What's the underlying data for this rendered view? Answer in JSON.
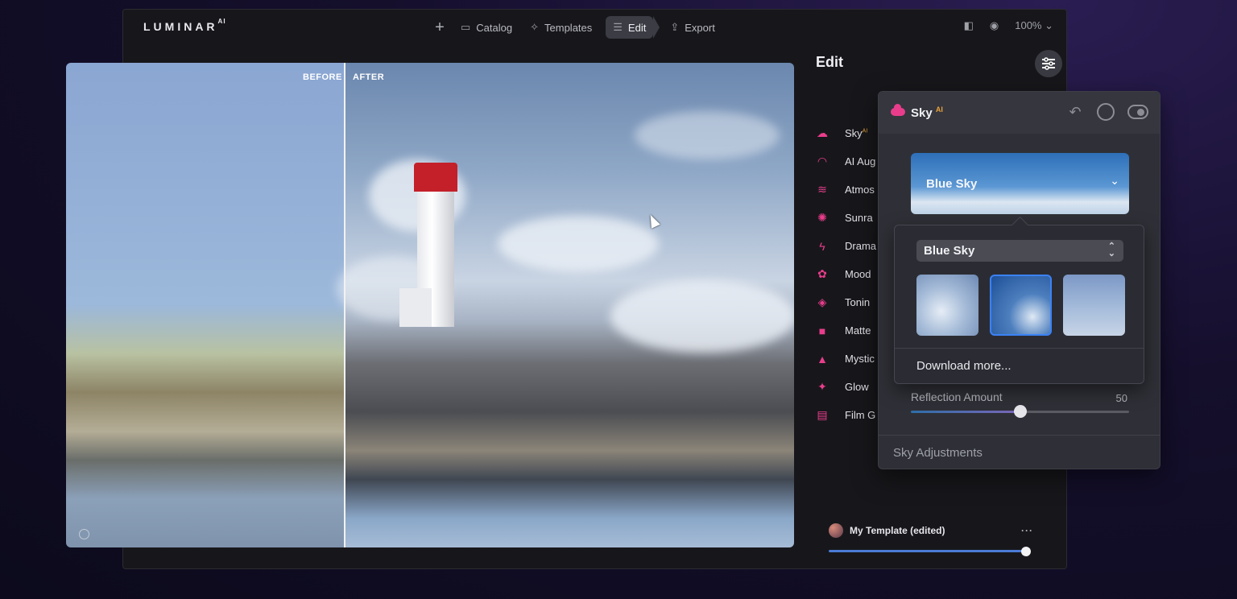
{
  "app": {
    "logo": "LUMINAR",
    "logo_sup": "AI"
  },
  "nav": {
    "plus": "+",
    "catalog": "Catalog",
    "templates": "Templates",
    "edit": "Edit",
    "export": "Export"
  },
  "view": {
    "zoom": "100%"
  },
  "canvas": {
    "before_label": "BEFORE",
    "after_label": "AFTER"
  },
  "sidebar": {
    "title": "Edit",
    "tools": [
      {
        "label": "Sky",
        "sup": "AI",
        "icon": "cloud-icon"
      },
      {
        "label": "AI Aug",
        "icon": "rainbow-icon"
      },
      {
        "label": "Atmos",
        "icon": "waves-icon"
      },
      {
        "label": "Sunra",
        "icon": "sun-icon"
      },
      {
        "label": "Drama",
        "icon": "bolt-icon"
      },
      {
        "label": "Mood",
        "icon": "flower-icon"
      },
      {
        "label": "Tonin",
        "icon": "paint-bucket-icon"
      },
      {
        "label": "Matte",
        "icon": "square-icon"
      },
      {
        "label": "Mystic",
        "icon": "cone-icon"
      },
      {
        "label": "Glow",
        "icon": "sparkle-icon"
      },
      {
        "label": "Film G",
        "icon": "film-icon"
      }
    ],
    "template": {
      "name": "My Template (edited)",
      "more": "···"
    }
  },
  "sky_panel": {
    "title": "Sky",
    "title_sup": "AI",
    "selected_sky": "Blue Sky",
    "popup": {
      "select_value": "Blue Sky",
      "thumbnails": [
        "sky-thumb-1",
        "sky-thumb-2",
        "sky-thumb-3"
      ],
      "selected_index": 1,
      "download_more": "Download more..."
    },
    "reflection": {
      "label": "Reflection Amount",
      "value": "50",
      "fraction": 0.5
    },
    "sky_adjustments": "Sky Adjustments"
  }
}
